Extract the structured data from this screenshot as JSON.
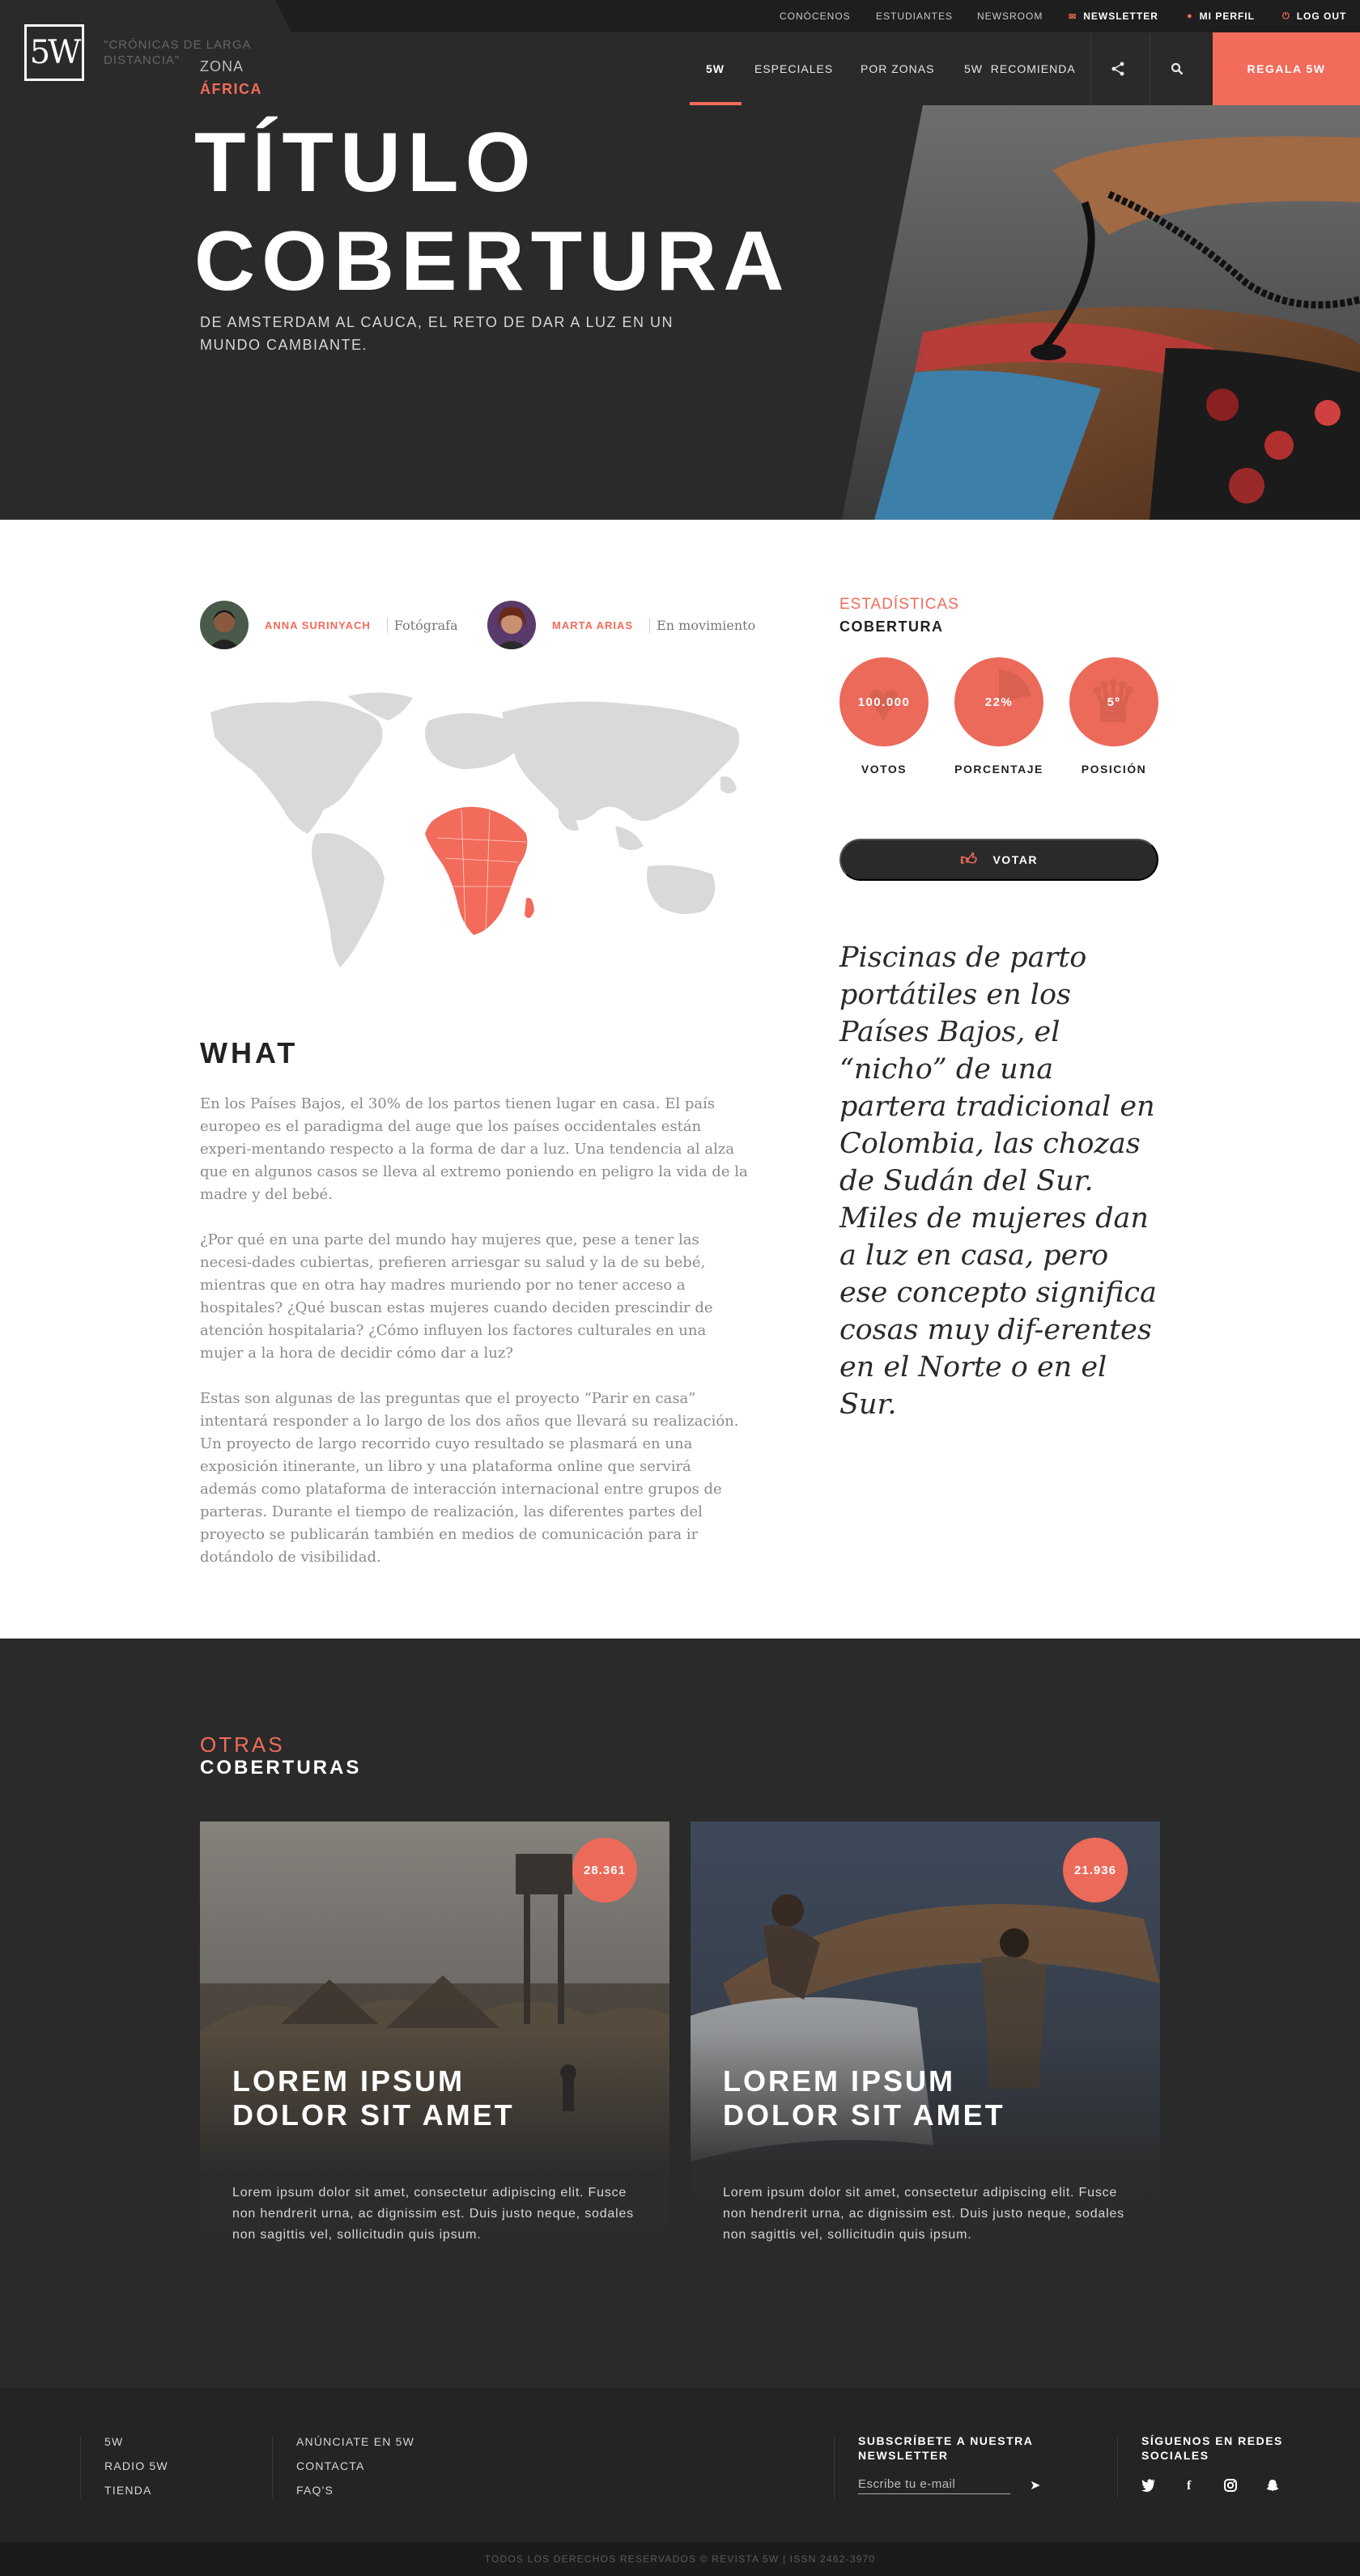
{
  "topbar": {
    "links": [
      "Conócenos",
      "Estudiantes",
      "Newsroom"
    ],
    "newsletter": "Newsletter",
    "profile": "Mi perfil",
    "logout": "Log out"
  },
  "nav": {
    "logo_text": "5W",
    "tagline": "\"Crónicas de larga distancia\"",
    "items": [
      "5W",
      "Especiales",
      "Por zonas",
      "5W  Recomienda"
    ],
    "cta": "Regala 5W"
  },
  "hero": {
    "zone_label": "Zona",
    "zone_value": "África",
    "title_line1": "Título",
    "title_line2": "Cobertura",
    "subtitle": "De Amsterdam al Cauca, el reto de dar a luz en un mundo cambiante."
  },
  "authors": [
    {
      "name": "Anna Surinyach",
      "role": "Fotógrafa"
    },
    {
      "name": "Marta Arias",
      "role": "En movimiento"
    }
  ],
  "article": {
    "heading": "What",
    "paragraphs": [
      "En los Países Bajos, el 30% de los partos tienen lugar en casa. El país europeo es el paradigma del auge que los países occidentales están experi-mentando respecto a la forma de dar a luz. Una tendencia al alza que en algunos casos se lleva al extremo poniendo en peligro la vida de la madre y del bebé.",
      "¿Por qué en una parte del mundo hay mujeres que, pese a tener las necesi-dades cubiertas, prefieren arriesgar su salud y la de su bebé, mientras que en otra hay madres muriendo por no tener acceso a hospitales? ¿Qué buscan estas mujeres cuando deciden prescindir de atención hospitalaria? ¿Cómo influyen los factores culturales en una mujer a la hora de decidir cómo dar a luz?",
      "Estas son algunas de las preguntas que el proyecto “Parir en casa” intentará responder a lo largo de los dos años que llevará su realización. Un proyecto de largo recorrido cuyo resultado se plasmará en una exposición itinerante, un libro y una plataforma online que servirá además como plataforma de interacción internacional entre grupos de parteras. Durante el tiempo de realización, las diferentes partes del proyecto se publicarán también en medios de comunicación para ir dotándolo de visibilidad."
    ]
  },
  "stats": {
    "kicker": "Estadísticas",
    "title": "Cobertura",
    "items": [
      {
        "value": "100.000",
        "label": "Votos",
        "icon": "heart-icon"
      },
      {
        "value": "22%",
        "label": "Porcentaje",
        "icon": "pie-icon",
        "fraction": 0.22
      },
      {
        "value": "5º",
        "label": "Posición",
        "icon": "trophy-icon"
      }
    ],
    "vote_label": "Votar"
  },
  "quote": "Piscinas de parto portátiles en los Países Bajos, el “nicho” de una partera tradicional en Colombia, las chozas de Sudán del Sur. Miles de mujeres dan a luz en casa, pero ese concepto significa cosas muy dif-erentes en el Norte o en el Sur.",
  "otras": {
    "kicker": "Otras",
    "title": "Coberturas",
    "cards": [
      {
        "badge": "28.361",
        "title": "Lorem ipsum dolor sit amet",
        "desc": "Lorem ipsum dolor sit amet, consectetur adipiscing elit. Fusce non hendrerit urna, ac dignissim est. Duis justo neque, sodales non sagittis vel, sollicitudin quis ipsum."
      },
      {
        "badge": "21.936",
        "title": "Lorem ipsum dolor sit amet",
        "desc": "Lorem ipsum dolor sit amet, consectetur adipiscing elit. Fusce non hendrerit urna, ac dignissim est. Duis justo neque, sodales non sagittis vel, sollicitudin quis ipsum."
      }
    ]
  },
  "footer": {
    "col1": [
      "5W",
      "Radio 5W",
      "Tienda"
    ],
    "col2": [
      "Anúnciate en 5W",
      "Contacta",
      "FAQ'S"
    ],
    "newsletter_heading": "Subscríbete a nuestra newsletter",
    "email_placeholder": "Escribe tu e-mail",
    "social_heading": "Síguenos en redes sociales",
    "social": [
      "twitter-icon",
      "facebook-icon",
      "instagram-icon",
      "snapchat-icon"
    ],
    "copyright": "Todos los derechos reservados © Revista 5W | ISSN 2462-3970"
  },
  "colors": {
    "accent": "#f26b5b",
    "dark": "#2a2a2a",
    "darker": "#1e1e1e"
  }
}
